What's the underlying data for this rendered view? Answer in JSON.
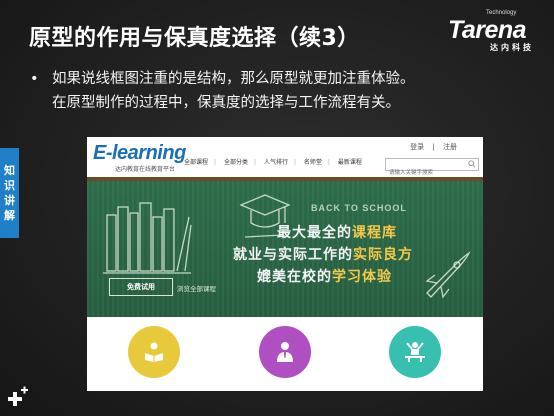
{
  "slide": {
    "title": "原型的作用与保真度选择（续3）",
    "bullet_symbol": "•",
    "bullet_line1": "如果说线框图注重的是结构，那么原型就更加注重体验。",
    "bullet_line2": "在原型制作的过程中，保真度的选择与工作流程有关。",
    "side_tab": [
      "知",
      "识",
      "讲",
      "解"
    ]
  },
  "brand": {
    "small": "Technology",
    "name": "Tarena",
    "sub": "达内科技"
  },
  "website": {
    "logo_text": "E-learning",
    "logo_sub": "达内教育在线教育平台",
    "login_link": "登录",
    "divider": "|",
    "register_link": "注册",
    "nav": [
      "全部课程",
      "全部分类",
      "人气排行",
      "名师堂",
      "最新课程"
    ],
    "search_placeholder": "请输入关键字搜索",
    "banner": {
      "back_to_school": "BACK TO SCHOOL",
      "line1_prefix": "最大最全的",
      "line1_highlight": "课程库",
      "line2_prefix": "就业与实际工作的",
      "line2_highlight": "实际良方",
      "line3_prefix": "媲美在校的",
      "line3_highlight": "学习体验",
      "trial_button": "免费试用",
      "browse_link": "浏览全部课程"
    },
    "feature_icons": [
      "reading-icon",
      "teacher-icon",
      "presentation-icon"
    ]
  },
  "colors": {
    "side_tab": "#1f80c9",
    "logo_blue": "#1b6fb8",
    "board_green": "#2d6e4b",
    "highlight_yellow": "#f3c94a",
    "circle_yellow": "#e8c93c",
    "circle_purple": "#b04fc2",
    "circle_teal": "#37bfb0"
  }
}
